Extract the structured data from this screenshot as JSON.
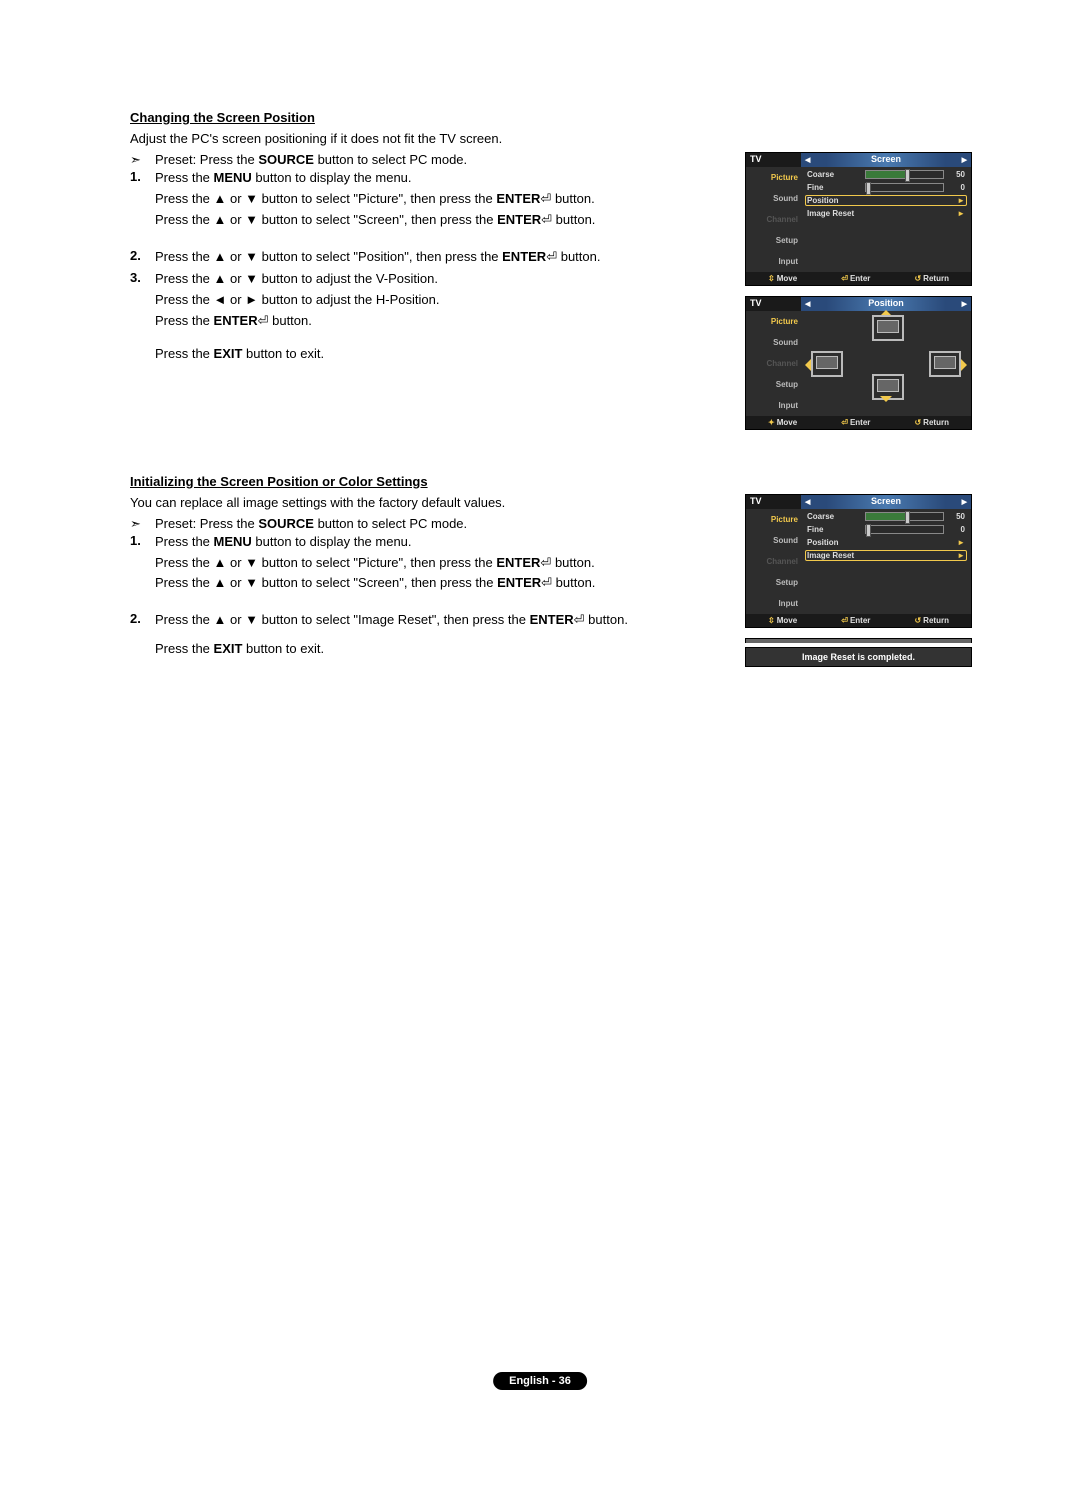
{
  "section1": {
    "heading": "Changing the Screen Position",
    "intro": "Adjust the PC's screen positioning if it does not fit the TV screen.",
    "preset_pre": "Preset: Press the ",
    "preset_btn": "SOURCE",
    "preset_post": " button to select PC mode.",
    "step1": {
      "num": "1.",
      "l1_pre": "Press the ",
      "l1_b": "MENU",
      "l1_post": " button to display the menu.",
      "l2_pre": "Press the ▲ or ▼ button to select \"Picture\", then press the ",
      "l2_b": "ENTER",
      "l2_post": " button.",
      "l3_pre": "Press the ▲ or ▼ button to select \"Screen\", then press the ",
      "l3_b": "ENTER",
      "l3_post": " button."
    },
    "step2": {
      "num": "2.",
      "l1_pre": "Press the ▲ or ▼ button to select \"Position\", then press the ",
      "l1_b": "ENTER",
      "l1_post": " button."
    },
    "step3": {
      "num": "3.",
      "l1": "Press the ▲ or ▼ button to adjust the V-Position.",
      "l2": "Press the ◄ or ► button to adjust the H-Position.",
      "l3_pre": "Press the ",
      "l3_b": "ENTER",
      "l3_post": " button.",
      "l4_pre": "Press the ",
      "l4_b": "EXIT",
      "l4_post": " button to exit."
    }
  },
  "section2": {
    "heading": "Initializing the Screen Position or Color Settings",
    "intro": "You can replace all image settings with the factory default values.",
    "preset_pre": "Preset: Press the ",
    "preset_btn": "SOURCE",
    "preset_post": " button to select PC mode.",
    "step1": {
      "num": "1.",
      "l1_pre": "Press the ",
      "l1_b": "MENU",
      "l1_post": " button to display the menu.",
      "l2_pre": "Press the ▲ or ▼ button to select \"Picture\", then press the ",
      "l2_b": "ENTER",
      "l2_post": " button.",
      "l3_pre": "Press the ▲ or ▼ button to select \"Screen\", then press the ",
      "l3_b": "ENTER",
      "l3_post": " button."
    },
    "step2": {
      "num": "2.",
      "l1_pre": "Press the ▲ or ▼ button to select \"Image Reset\", then press the ",
      "l1_b": "ENTER",
      "l1_post": " button.",
      "l2_pre": "Press the ",
      "l2_b": "EXIT",
      "l2_post": " button to exit."
    }
  },
  "osd_labels": {
    "tv": "TV",
    "screen": "Screen",
    "position": "Position",
    "coarse": "Coarse",
    "fine": "Fine",
    "image_reset": "Image Reset",
    "side_picture": "Picture",
    "side_sound": "Sound",
    "side_channel": "Channel",
    "side_setup": "Setup",
    "side_input": "Input",
    "move": "Move",
    "enter": "Enter",
    "return": "Return",
    "coarse_val": "50",
    "fine_val": "0",
    "reset_msg": "Image Reset is completed."
  },
  "footer": "English - 36"
}
